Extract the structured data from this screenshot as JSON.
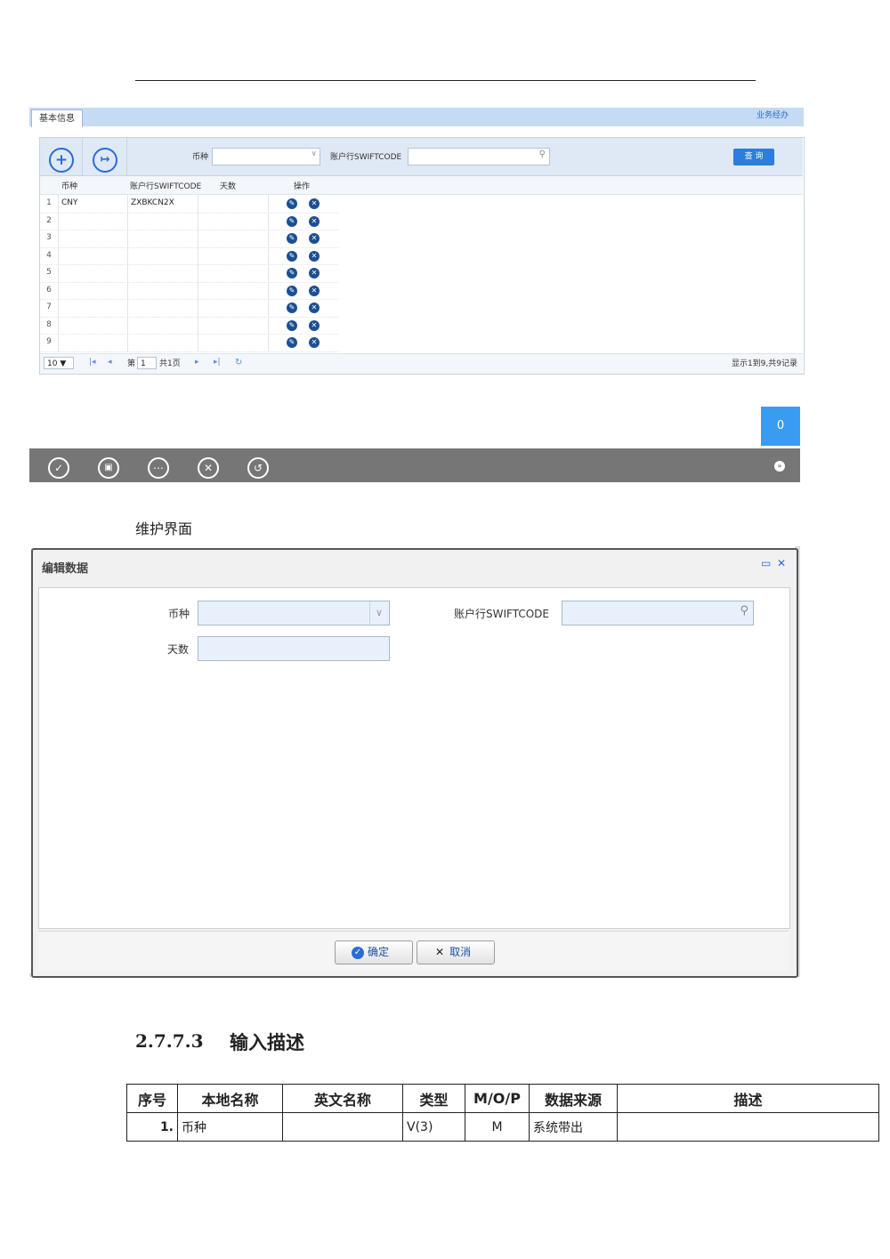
{
  "screen1": {
    "tab_label": "基本信息",
    "top_link": "业务经办",
    "filter": {
      "currency_label": "币种",
      "swift_label": "账户行SWIFTCODE",
      "query_button": "查 询"
    },
    "grid": {
      "columns": [
        "币种",
        "账户行SWIFTCODE",
        "天数",
        "操作"
      ],
      "rows": [
        {
          "num": "1",
          "currency": "CNY",
          "swift": "ZXBKCN2X",
          "days": ""
        },
        {
          "num": "2",
          "currency": "",
          "swift": "",
          "days": ""
        },
        {
          "num": "3",
          "currency": "",
          "swift": "",
          "days": ""
        },
        {
          "num": "4",
          "currency": "",
          "swift": "",
          "days": ""
        },
        {
          "num": "5",
          "currency": "",
          "swift": "",
          "days": ""
        },
        {
          "num": "6",
          "currency": "",
          "swift": "",
          "days": ""
        },
        {
          "num": "7",
          "currency": "",
          "swift": "",
          "days": ""
        },
        {
          "num": "8",
          "currency": "",
          "swift": "",
          "days": ""
        },
        {
          "num": "9",
          "currency": "",
          "swift": "",
          "days": ""
        }
      ]
    },
    "pager": {
      "page_size": "10 ▼",
      "page_prefix": "第",
      "page_value": "1",
      "page_total": "共1页",
      "summary": "显示1到9,共9记录"
    }
  },
  "screen2": {
    "badge": "0"
  },
  "caption": "维护界面",
  "dialog": {
    "title": "编辑数据",
    "currency_label": "币种",
    "swift_label": "账户行SWIFTCODE",
    "days_label": "天数",
    "ok_button": "确定",
    "cancel_button": "取消"
  },
  "section": {
    "number": "2.7.7.3",
    "title": "输入描述"
  },
  "spec_table": {
    "headers": [
      "序号",
      "本地名称",
      "英文名称",
      "类型",
      "M/O/P",
      "数据来源",
      "描述"
    ],
    "rows": [
      {
        "seq": "1.",
        "local_name": "币种",
        "english_name": "",
        "type": "V(3)",
        "mop": "M",
        "source": "系统带出",
        "desc": ""
      }
    ]
  }
}
